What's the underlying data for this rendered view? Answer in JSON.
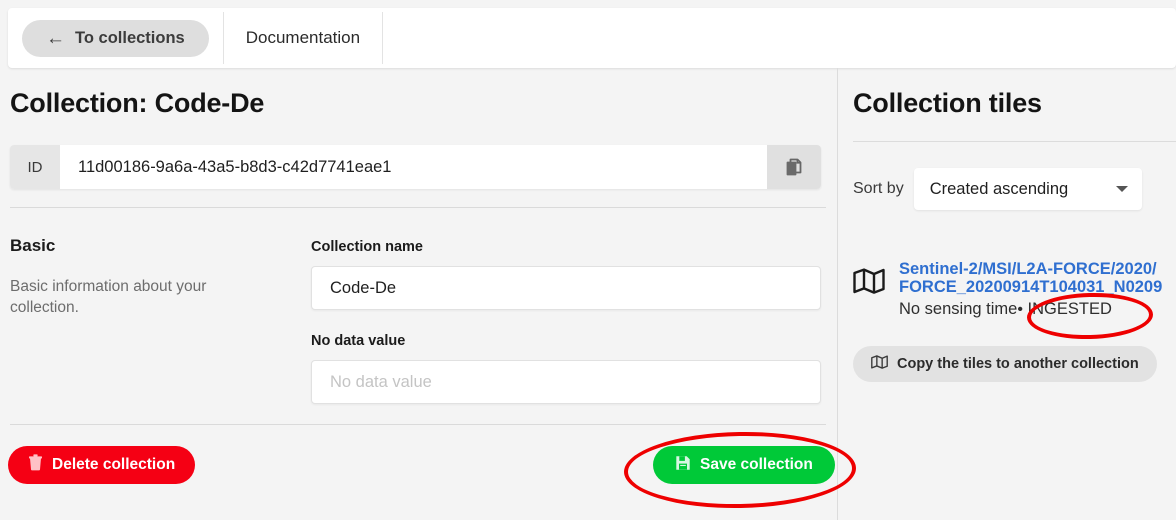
{
  "tabs": [
    {
      "label": "To collections",
      "icon": "arrow-left-icon",
      "style": "pill"
    },
    {
      "label": "Documentation",
      "icon": "",
      "style": "plain"
    }
  ],
  "left": {
    "page_title": "Collection: Code-De",
    "id_label": "ID",
    "id_value": "11d00186-9a6a-43a5-b8d3-c42d7741eae1",
    "copy_icon": "copy-icon",
    "basic_heading": "Basic",
    "basic_description": "Basic information about your collection.",
    "fields": {
      "collection_name_label": "Collection name",
      "collection_name_value": "Code-De",
      "no_data_value_label": "No data value",
      "no_data_value_placeholder": "No data value"
    },
    "delete_button": {
      "label": "Delete collection",
      "icon": "trash-icon",
      "color": "#f50014"
    },
    "save_button": {
      "label": "Save collection",
      "icon": "save-disk-icon",
      "color": "#00c938"
    }
  },
  "right": {
    "title": "Collection tiles",
    "sort_label": "Sort by",
    "sort_value": "Created ascending",
    "sort_caret": "chevron-down-icon",
    "tile": {
      "icon": "map-icon",
      "link_line1": "Sentinel-2/MSI/L2A-FORCE/2020/",
      "link_line2": "FORCE_20200914T104031_N0209",
      "meta_text": "No sensing time",
      "status_separator": "•",
      "status": "INGESTED",
      "link_color": "#2f6fd0"
    },
    "copy_tiles_button": {
      "label": "Copy the tiles to another collection",
      "icon": "map-icon"
    }
  },
  "annotations": {
    "color": "#ee0000",
    "shapes": [
      {
        "name": "ingested-status-ellipse",
        "target": "INGESTED"
      },
      {
        "name": "save-collection-ellipse",
        "target": "Save collection"
      }
    ]
  }
}
